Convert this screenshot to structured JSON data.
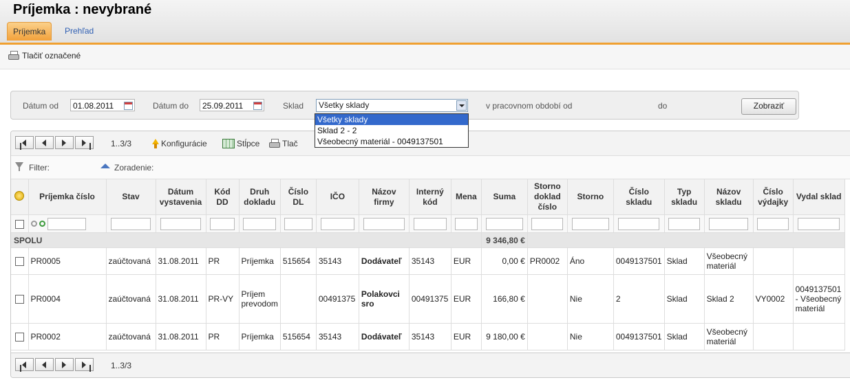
{
  "title": "Príjemka :  nevybrané",
  "tabs": [
    {
      "label": "Príjemka",
      "active": true
    },
    {
      "label": "Prehľad",
      "active": false
    }
  ],
  "print_selected": "Tlačiť označené",
  "filter": {
    "date_from_label": "Dátum od",
    "date_from": "01.08.2011",
    "date_to_label": "Dátum do",
    "date_to": "25.09.2011",
    "warehouse_label": "Sklad",
    "warehouse_selected": "Všetky sklady",
    "warehouse_options": [
      "Všetky sklady",
      "Sklad 2 - 2",
      "Všeobecný materiál - 0049137501"
    ],
    "period_label": "v pracovnom období od",
    "period_to_label": "do",
    "show_button": "Zobraziť"
  },
  "grid": {
    "pager_info": "1..3/3",
    "toolbar": {
      "config": "Konfigurácie",
      "columns": "Stĺpce",
      "print": "Tlač"
    },
    "filter_label": "Filter:",
    "sort_label": "Zoradenie:",
    "columns": [
      "Príjemka číslo",
      "Stav",
      "Dátum vystavenia",
      "Kód DD",
      "Druh dokladu",
      "Číslo DL",
      "IČO",
      "Názov firmy",
      "Interný kód",
      "Mena",
      "Suma",
      "Storno doklad číslo",
      "Storno",
      "Číslo skladu",
      "Typ skladu",
      "Názov skladu",
      "Číslo výdajky",
      "Vydal sklad"
    ],
    "sum_label": "SPOLU",
    "sum_value": "9 346,80 €",
    "rows": [
      {
        "cells": [
          "PR0005",
          "zaúčtovaná",
          "31.08.2011",
          "PR",
          "Príjemka",
          "515654",
          "35143",
          "Dodávateľ",
          "35143",
          "EUR",
          "0,00 €",
          "PR0002",
          "Áno",
          "0049137501",
          "Sklad",
          "Všeobecný materiál",
          "",
          ""
        ]
      },
      {
        "cells": [
          "PR0004",
          "zaúčtovaná",
          "31.08.2011",
          "PR-VY",
          "Príjem prevodom",
          "",
          "00491375",
          "Polakovci sro",
          "00491375",
          "EUR",
          "166,80 €",
          "",
          "Nie",
          "2",
          "Sklad",
          "Sklad 2",
          "VY0002",
          "0049137501 - Všeobecný materiál"
        ]
      },
      {
        "cells": [
          "PR0002",
          "zaúčtovaná",
          "31.08.2011",
          "PR",
          "Príjemka",
          "515654",
          "35143",
          "Dodávateľ",
          "35143",
          "EUR",
          "9 180,00 €",
          "",
          "Nie",
          "0049137501",
          "Sklad",
          "Všeobecný materiál",
          "",
          ""
        ]
      }
    ]
  }
}
